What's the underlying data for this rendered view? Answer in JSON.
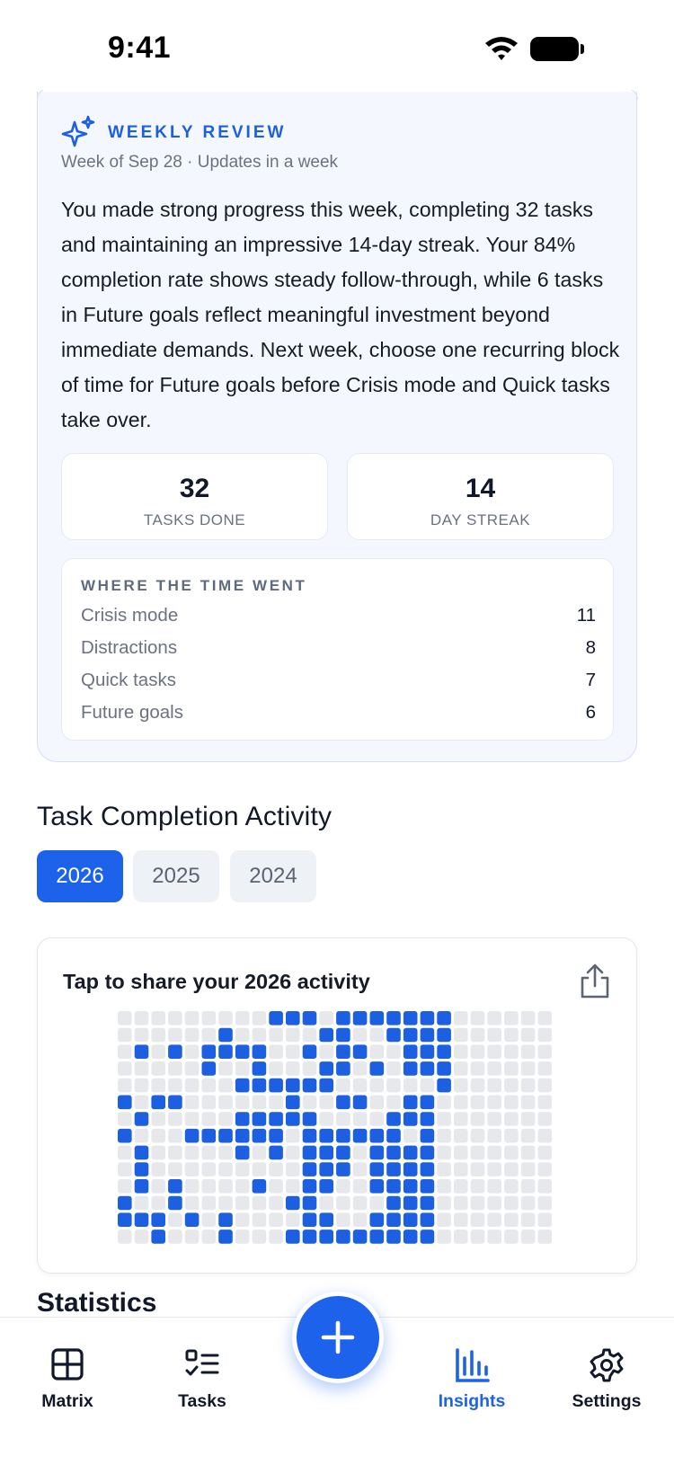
{
  "status_bar": {
    "time": "9:41"
  },
  "review": {
    "title": "WEEKLY REVIEW",
    "subtitle": "Week of Sep 28 · Updates in a week",
    "body": "You made strong progress this week, completing 32 tasks and maintaining an impressive 14-day streak. Your 84% completion rate shows steady follow-through, while 6 tasks in Future goals reflect meaningful investment beyond immediate demands. Next week, choose one recurring block of time for Future goals before Crisis mode and Quick tasks take over.",
    "stats": [
      {
        "value": "32",
        "label": "TASKS DONE"
      },
      {
        "value": "14",
        "label": "DAY STREAK"
      }
    ],
    "time_title": "WHERE THE TIME WENT",
    "time_rows": [
      {
        "label": "Crisis mode",
        "value": "11"
      },
      {
        "label": "Distractions",
        "value": "8"
      },
      {
        "label": "Quick tasks",
        "value": "7"
      },
      {
        "label": "Future goals",
        "value": "6"
      }
    ]
  },
  "activity": {
    "section_title": "Task Completion Activity",
    "years": [
      "2026",
      "2025",
      "2024"
    ],
    "selected_year": "2026",
    "card_title": "Tap to share your 2026 activity",
    "grid_columns": 26,
    "grid_rows": 14,
    "grid_rows_filled": [
      [
        9,
        10,
        11,
        13,
        14,
        15,
        16,
        17,
        18,
        19
      ],
      [
        6,
        12,
        13,
        16,
        17,
        18,
        19
      ],
      [
        1,
        3,
        5,
        6,
        7,
        8,
        11,
        13,
        14,
        17,
        18,
        19
      ],
      [
        5,
        8,
        12,
        13,
        15,
        17,
        18,
        19
      ],
      [
        7,
        8,
        9,
        10,
        11,
        12,
        19
      ],
      [
        0,
        2,
        3,
        10,
        13,
        14,
        17,
        18
      ],
      [
        1,
        7,
        8,
        9,
        10,
        11,
        16,
        17,
        18
      ],
      [
        0,
        4,
        5,
        6,
        7,
        8,
        9,
        11,
        12,
        13,
        14,
        15,
        16,
        18
      ],
      [
        1,
        7,
        9,
        11,
        12,
        13,
        15,
        16,
        17,
        18
      ],
      [
        1,
        11,
        12,
        13,
        15,
        16,
        17,
        18
      ],
      [
        1,
        3,
        8,
        11,
        12,
        15,
        16,
        17,
        18
      ],
      [
        0,
        3,
        10,
        11,
        16,
        17,
        18
      ],
      [
        0,
        1,
        2,
        4,
        6,
        11,
        12,
        15,
        16,
        17,
        18
      ],
      [
        2,
        6,
        10,
        11,
        12,
        13,
        14,
        15,
        16,
        17,
        18
      ]
    ]
  },
  "statistics_heading": "Statistics",
  "nav": {
    "tabs": [
      {
        "label": "Matrix",
        "icon": "grid-icon"
      },
      {
        "label": "Tasks",
        "icon": "checklist-icon"
      },
      {
        "label": "Insights",
        "icon": "bar-chart-icon"
      },
      {
        "label": "Settings",
        "icon": "gear-icon"
      }
    ],
    "active_tab": "Insights"
  },
  "colors": {
    "accent": "#1c62eb",
    "cell_filled": "#1c5fe0",
    "cell_empty": "#e6e8ec"
  }
}
